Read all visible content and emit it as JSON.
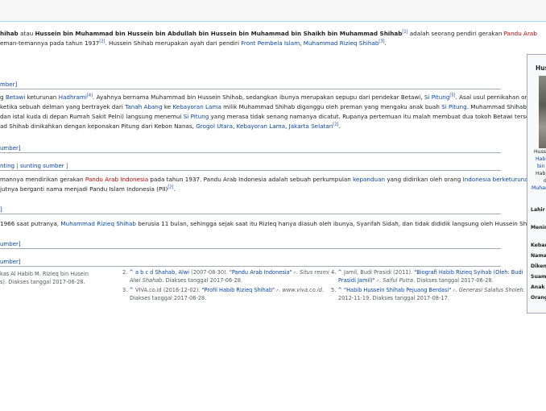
{
  "intro": {
    "l1": {
      "a": "hihab",
      "b": " atau ",
      "c": "Hussein bin Muhammad bin Hussein bin Abdullah bin Hussein bin Muhammad bin Shaikh bin Muhammad Shihab",
      "d": " adalah seorang pendiri gerakan ",
      "e": "Pandu Arab"
    },
    "l2": {
      "a": "eman-temannya pada tahun 1937",
      "b": ". Hussein Shihab merupakan ayah dari pendiri ",
      "c": "Front Pembela Islam",
      "d": ", ",
      "e": "Muhammad Rizieq Shihab",
      "f": "."
    },
    "cite1": "[1]",
    "cite2": "[2]",
    "cite3": "[3]"
  },
  "sec1": {
    "heading": "mber]",
    "l1": {
      "a": "g ",
      "b": "Betawi",
      "c": " keturunan ",
      "d": "Hadhrami",
      "e": "[4]",
      "f": ". Ayahnya bernama Muhammad bin Hussein Shihab, sedangkan ibunya merupakan sepupu dari pendekar Betawi, ",
      "g": "Si Pitung",
      "h": "[5]",
      "i": ". Asal usul pernikahan orang"
    },
    "l2": {
      "a": " ketika sebuah delman yang bertrayek dari ",
      "b": "Tanah Abang",
      "c": " ke ",
      "d": "Kebayoran Lama",
      "e": " milik Muhammad Shihab diganggu oleh preman yang mengaku anak buah ",
      "f": "Si Pitung",
      "g": ". Muhammad Shihab (yang"
    },
    "l3": {
      "a": " dan istal kuda di depan Rumah Sakit Pelni) langsung menemui ",
      "b": "Si Pitung",
      "c": " yang merasa tidak senang namanya dicatut. Rupanya pertemuan itu malah membuat dua tokoh Betawi tersebut"
    },
    "l4": {
      "a": "ad Shihab dinikahkan dengan keponakan Pitung dari Kebon Nanas, ",
      "b": "Grogol Utara",
      "c": ", ",
      "d": "Kebayoran Lama",
      "e": ", ",
      "f": "Jakarta Selatan",
      "g": "[2]",
      "h": "."
    }
  },
  "sec2": {
    "heading": "umber]"
  },
  "sec3": {
    "heading": {
      "a": "nting",
      "b": " | ",
      "c": "sunting sumber",
      "d": " ]"
    },
    "l1": {
      "a": "mannya mendirikan gerakan ",
      "b": "Pandu Arab Indonesia",
      "c": " pada tahun 1937. Pandu Arab Indonesia adalah sebuah perkumpulan ",
      "d": "kepanduan",
      "e": " yang didirikan oleh orang ",
      "f": "Indonesia berketurunan Arab"
    },
    "l2": {
      "a": "jutnya berganti nama menjadi Pandu Islam Indonesia (PII)",
      "b": "[2]",
      "c": "."
    }
  },
  "sec4": {
    "heading": "]",
    "l1": {
      "a": "1966 saat putranya, ",
      "b": "Muhammad Rizieq Shihab",
      "c": " berusia 11 bulan, sehingga sejak saat itu Rizieq hanya diasuh oleh ibunya, Syarifah Sidah, dan tidak dididik langsung oleh Hussein Shihab."
    }
  },
  "sec5": {
    "heading": "umber]"
  },
  "sec6": {
    "heading": "umber]"
  },
  "refs": {
    "c1": {
      "l1": "kas Al Habib M. Rizieq bin Husein",
      "l2": "s). Diakses tanggal 2017-06-28."
    },
    "r2": {
      "num": "2.",
      "marks": "^ a b c d",
      "a": "Shahab, Alwi",
      "b": " (2007-08-30). ",
      "c": "\"Pandu Arab Indonesia\"",
      "d": ". ",
      "e": "Situs resmi",
      "f": "Alwi Shahab",
      "g": ". Diakses tanggal 2017-06-28."
    },
    "r3": {
      "num": "3.",
      "mark": "^",
      "a": " VIVA.co.id (2016-12-02). ",
      "b": "\"Profil Habib Rizieq Shihab\"",
      "c": ". ",
      "d": "www.viva.co.id",
      "e": ".",
      "f": "Diakses tanggal 2017-06-28."
    },
    "r4": {
      "num": "4.",
      "mark": "^",
      "a": " Jamil, Budi Prasidi (2011). ",
      "b": "\"Biografi Habib Rizieq Syihab (Oleh: Budi",
      "c": "Prasidi Jamil)\"",
      "d": ". ",
      "e": "Saiful Putra",
      "f": ". Diakses tanggal 2017-06-28."
    },
    "r5": {
      "num": "5.",
      "mark": "^",
      "b": " \"Habib Hussein Shihab Pejuang Berdasi\"",
      "c": ". ",
      "d": "Generasi Salafus Sholeh",
      "e": ".",
      "f": "2012-11-19. Diakses tanggal 2017-08-17."
    }
  },
  "infobox": {
    "title": "Hus",
    "cap1": "Huss",
    "cap2": "Habib",
    "cap3": "bin A",
    "cap4": "Habib",
    "cap5": "d",
    "cap6": "Muham",
    "lahir": "Lahir",
    "meninggal": "Menin",
    "kebangsaan": "Keban",
    "nama": "Nama",
    "dikenal": "Diken",
    "suami": "Suami",
    "anak": "Anak",
    "orangtua": "Orang"
  }
}
